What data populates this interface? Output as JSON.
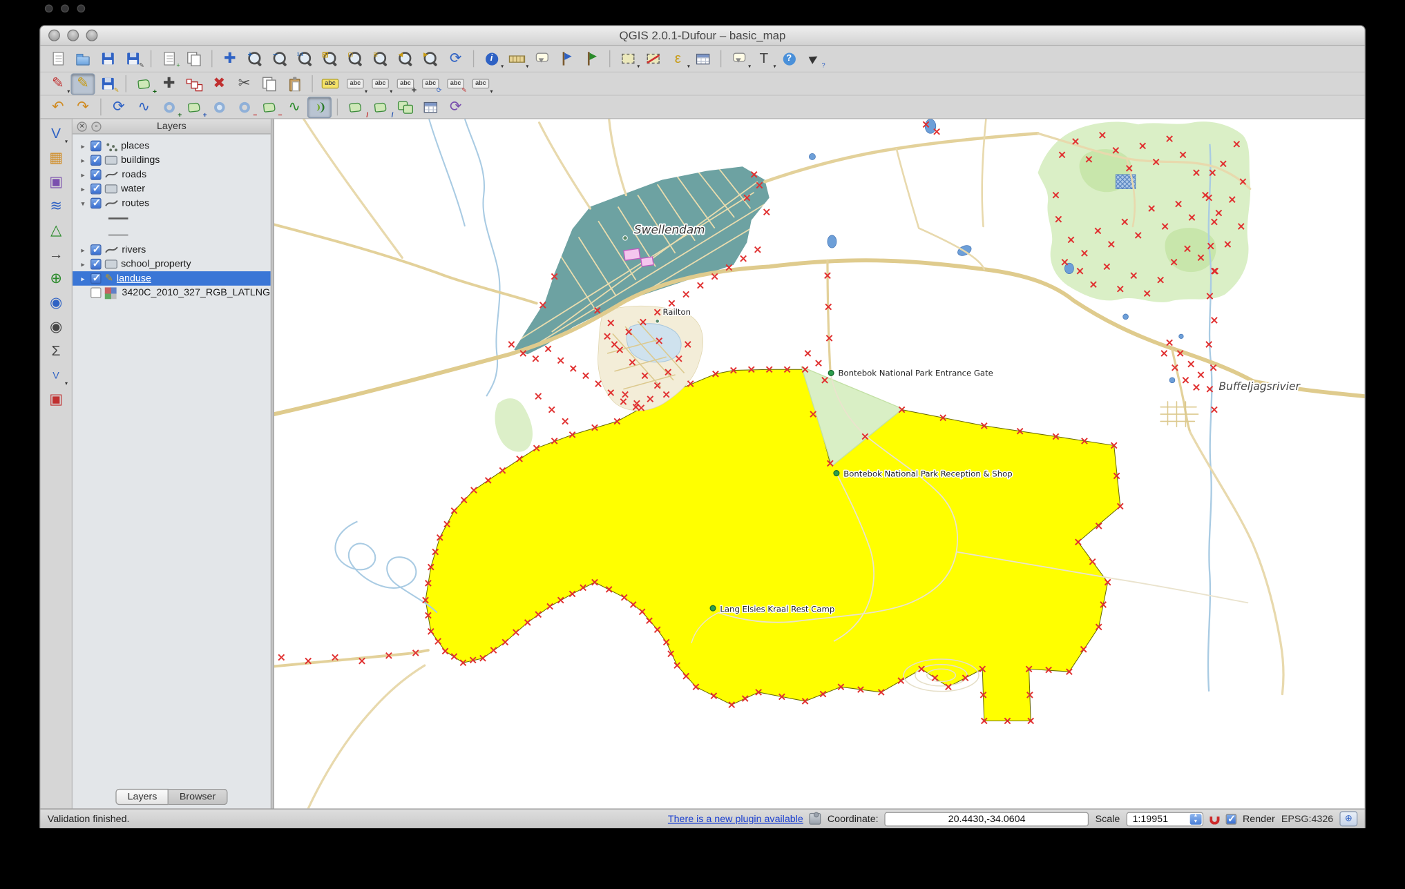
{
  "window": {
    "title": "QGIS 2.0.1-Dufour – basic_map"
  },
  "layers_panel": {
    "title": "Layers",
    "items": [
      {
        "label": "places",
        "checked": true
      },
      {
        "label": "buildings",
        "checked": true
      },
      {
        "label": "roads",
        "checked": true
      },
      {
        "label": "water",
        "checked": true
      },
      {
        "label": "routes",
        "checked": true,
        "expanded": true
      },
      {
        "label": "rivers",
        "checked": true
      },
      {
        "label": "school_property",
        "checked": true
      },
      {
        "label": "landuse",
        "checked": true,
        "selected": true,
        "editing": true
      },
      {
        "label": "3420C_2010_327_RGB_LATLNG",
        "checked": false
      }
    ],
    "tabs": [
      {
        "label": "Layers",
        "active": true
      },
      {
        "label": "Browser",
        "active": false
      }
    ]
  },
  "map": {
    "labels": {
      "swellendam": "Swellendam",
      "railton": "Railton",
      "entrance_gate": "Bontebok National Park Entrance Gate",
      "reception": "Bontebok National Park Reception & Shop",
      "rest_camp": "Lang Elsies Kraal Rest Camp",
      "buffeljagsrivier": "Buffeljagsrivier"
    }
  },
  "status_bar": {
    "message": "Validation finished.",
    "plugin_link": "There is a new plugin available",
    "coordinate_label": "Coordinate:",
    "coordinate_value": "20.4430,-34.0604",
    "scale_label": "Scale",
    "scale_value": "1:19951",
    "render_label": "Render",
    "crs_label": "EPSG:4326"
  },
  "icons": {
    "dropdown": "▾",
    "up": "▴",
    "collapsed": "▸",
    "expanded": "▾",
    "close": "✕",
    "float": "▫",
    "pan": "✚",
    "zoom_plus": "+",
    "zoom_minus": "−",
    "zoom_native": "1:1",
    "zoom_full": "⊞",
    "zoom_selection": "▢",
    "zoom_layer": "≣",
    "zoom_last": "◀",
    "zoom_next": "▶",
    "refresh": "⟳",
    "identify": "i",
    "expression": "ε",
    "text": "T",
    "help": "?",
    "whats_this": "?",
    "pencil": "✎",
    "delete": "✖",
    "scissors": "✂",
    "plus": "+",
    "minus": "−",
    "slash": "/",
    "undo": "↶",
    "redo": "↷",
    "rotate": "⟳",
    "simplify": "∿",
    "reshape": "∿",
    "abc": "abc",
    "vector": "V",
    "grid": "▦",
    "wave": "≋",
    "triangle": "△",
    "arrow": "→",
    "oplus": "⊕",
    "target": "◉",
    "sigma": "Σ",
    "square": "▣"
  }
}
